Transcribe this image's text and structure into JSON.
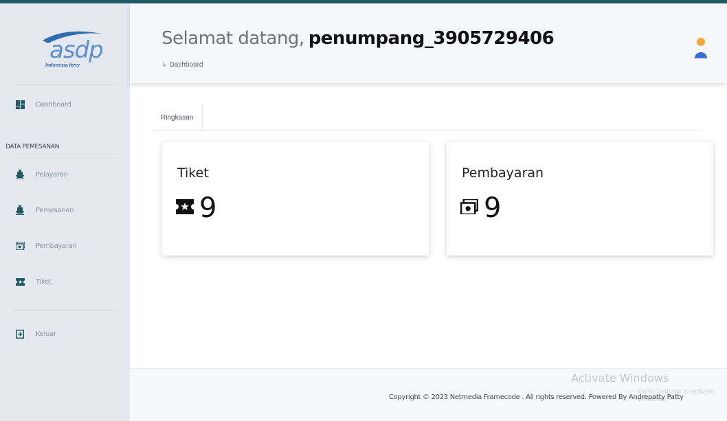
{
  "brand": {
    "logo_text": "asdp",
    "logo_sub": "Indonesia ferry"
  },
  "sidebar": {
    "items": [
      {
        "label": "Dashboard",
        "icon": "dashboard-grid-icon"
      },
      {
        "label": "Pelayaran",
        "icon": "ship-icon"
      },
      {
        "label": "Pemesanan",
        "icon": "ship-icon"
      },
      {
        "label": "Pembayaran",
        "icon": "money-bill-icon"
      },
      {
        "label": "Tiket",
        "icon": "ticket-icon"
      },
      {
        "label": "Keluar",
        "icon": "logout-icon"
      }
    ],
    "section_label": "DATA PEMESANAN"
  },
  "header": {
    "greeting": "Selamat datang,",
    "username": "penumpang_3905729406",
    "breadcrumb": "Dashboard"
  },
  "tabs": [
    {
      "label": "Ringkasan"
    }
  ],
  "cards": [
    {
      "title": "Tiket",
      "value": "9",
      "icon": "ticket-icon"
    },
    {
      "title": "Pembayaran",
      "value": "9",
      "icon": "money-bill-icon"
    }
  ],
  "footer": {
    "copyright": "Copyright © 2023 Netmedia Framecode . All rights reserved. Powered By Andrepatty Patty"
  },
  "watermark": {
    "line1": "Activate Windows",
    "line2": "Go to Settings to activate Windows."
  },
  "colors": {
    "topline": "#1f5a66",
    "sidebar_bg": "#e5e9ef",
    "nav_icon": "#1f5a66",
    "avatar_head": "#f0a83a",
    "avatar_body": "#3b6fd8"
  }
}
